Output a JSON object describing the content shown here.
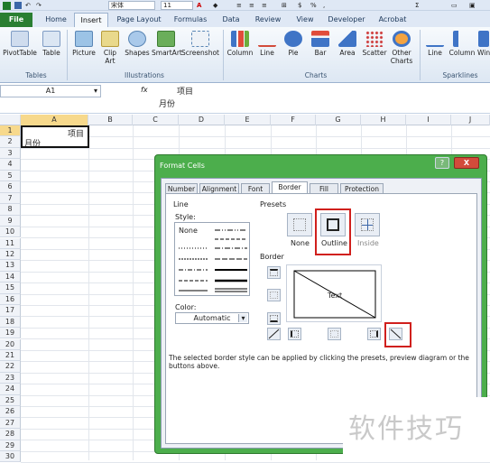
{
  "qat": {
    "font_name": "宋体",
    "font_size": "11"
  },
  "tabs": [
    "File",
    "Home",
    "Insert",
    "Page Layout",
    "Formulas",
    "Data",
    "Review",
    "View",
    "Developer",
    "Acrobat"
  ],
  "ribbon": {
    "buttons": [
      "PivotTable",
      "Table",
      "Picture",
      "Clip Art",
      "Shapes",
      "SmartArt",
      "Screenshot",
      "Column",
      "Line",
      "Pie",
      "Bar",
      "Area",
      "Scatter",
      "Other Charts",
      "Line",
      "Column",
      "Win"
    ],
    "clip_art_label": [
      "Clip",
      "Art"
    ],
    "other_charts_label": [
      "Other",
      "Charts"
    ],
    "groups": [
      "Tables",
      "Illustrations",
      "Charts",
      "Sparklines"
    ]
  },
  "formula": {
    "name_box": "A1",
    "fx": "fx",
    "content_line1": "项目",
    "content_line2": "月份"
  },
  "columns": [
    "A",
    "B",
    "C",
    "D",
    "E",
    "F",
    "G",
    "H",
    "I",
    "J"
  ],
  "rows": [
    "1",
    "2",
    "3",
    "4",
    "5",
    "6",
    "7",
    "8",
    "9",
    "10",
    "11",
    "12",
    "13",
    "14",
    "15",
    "16",
    "17",
    "18",
    "19",
    "20",
    "21",
    "22",
    "23",
    "24",
    "25",
    "26",
    "27",
    "28",
    "29",
    "30"
  ],
  "cell_a1": {
    "line1": "项目",
    "line2": "月份"
  },
  "dialog": {
    "title": "Format Cells",
    "help": "?",
    "close": "X",
    "tabs": [
      "Number",
      "Alignment",
      "Font",
      "Border",
      "Fill",
      "Protection"
    ],
    "line_label": "Line",
    "style_label": "Style:",
    "style_none": "None",
    "color_label": "Color:",
    "color_value": "Automatic",
    "presets_label": "Presets",
    "presets": [
      "None",
      "Outline",
      "Inside"
    ],
    "border_label": "Border",
    "preview_text": "Text",
    "hint": "The selected border style can be applied by clicking the presets, preview diagram or the buttons above."
  },
  "watermark": "软件技巧",
  "colors": {
    "file_tab": "#2a7f32",
    "dialog_frame": "#4cae4c",
    "highlight": "#d0201d"
  }
}
